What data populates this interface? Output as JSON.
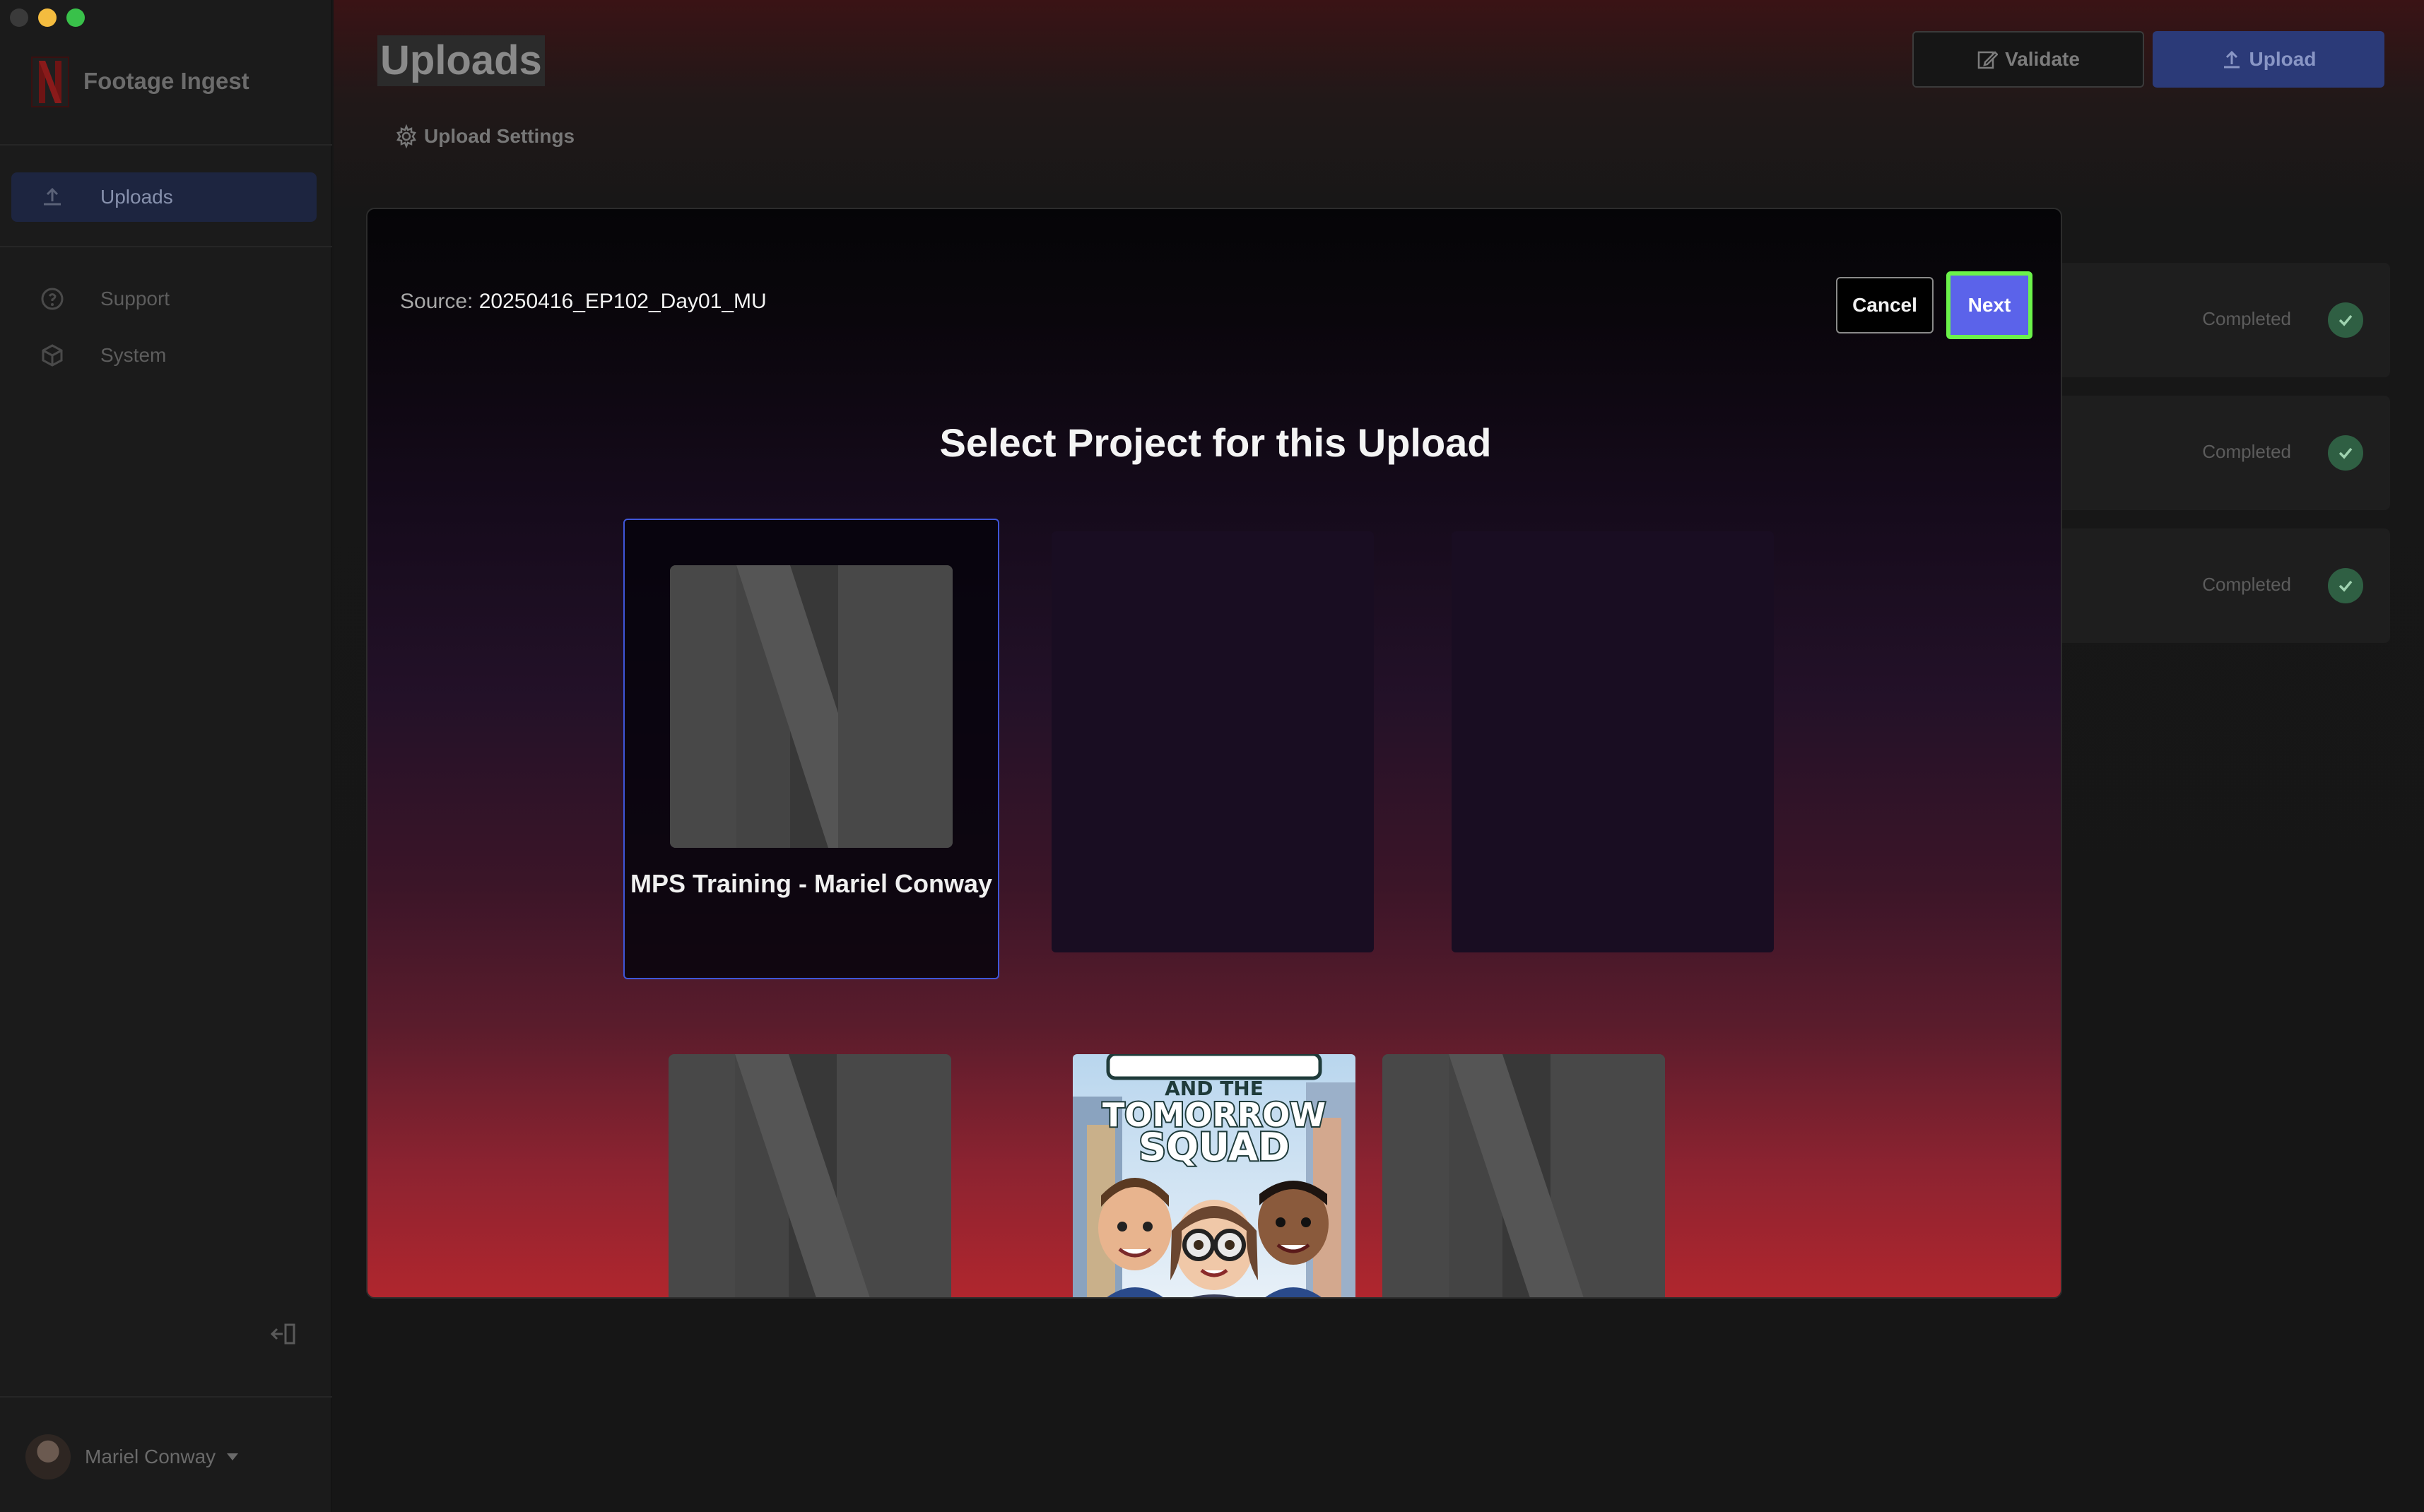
{
  "app": {
    "title": "Footage Ingest"
  },
  "sidebar": {
    "items": [
      {
        "label": "Uploads",
        "icon": "upload-icon",
        "active": true
      },
      {
        "label": "Support",
        "icon": "help-circle-icon",
        "active": false
      },
      {
        "label": "System",
        "icon": "cube-icon",
        "active": false
      }
    ]
  },
  "user": {
    "name": "Mariel Conway"
  },
  "page": {
    "title": "Uploads",
    "settings_label": "Upload Settings",
    "validate_label": "Validate",
    "upload_label": "Upload"
  },
  "uploads": [
    {
      "status": "Completed"
    },
    {
      "status": "Completed"
    },
    {
      "status": "Completed"
    }
  ],
  "modal": {
    "source_label": "Source:",
    "source_value": "20250416_EP102_Day01_MU",
    "cancel_label": "Cancel",
    "next_label": "Next",
    "title": "Select Project for this Upload",
    "projects": [
      {
        "name": "MPS Training - Mariel Conway",
        "image": "netflix-n-placeholder",
        "selected": true
      },
      {
        "name": "",
        "image": "loading-placeholder"
      },
      {
        "name": "",
        "image": "loading-placeholder"
      },
      {
        "name": "",
        "image": "netflix-n-placeholder"
      },
      {
        "name": "",
        "image": "poster-tomorrow-squad",
        "poster_line1": "AND THE",
        "poster_line2": "TOMORROW",
        "poster_line3": "SQUAD"
      },
      {
        "name": "",
        "image": "netflix-n-placeholder"
      }
    ]
  },
  "colors": {
    "accent": "#5b63ea",
    "highlight": "#6bf24a",
    "success": "#2f5f43",
    "brand_red": "#b0262e"
  }
}
